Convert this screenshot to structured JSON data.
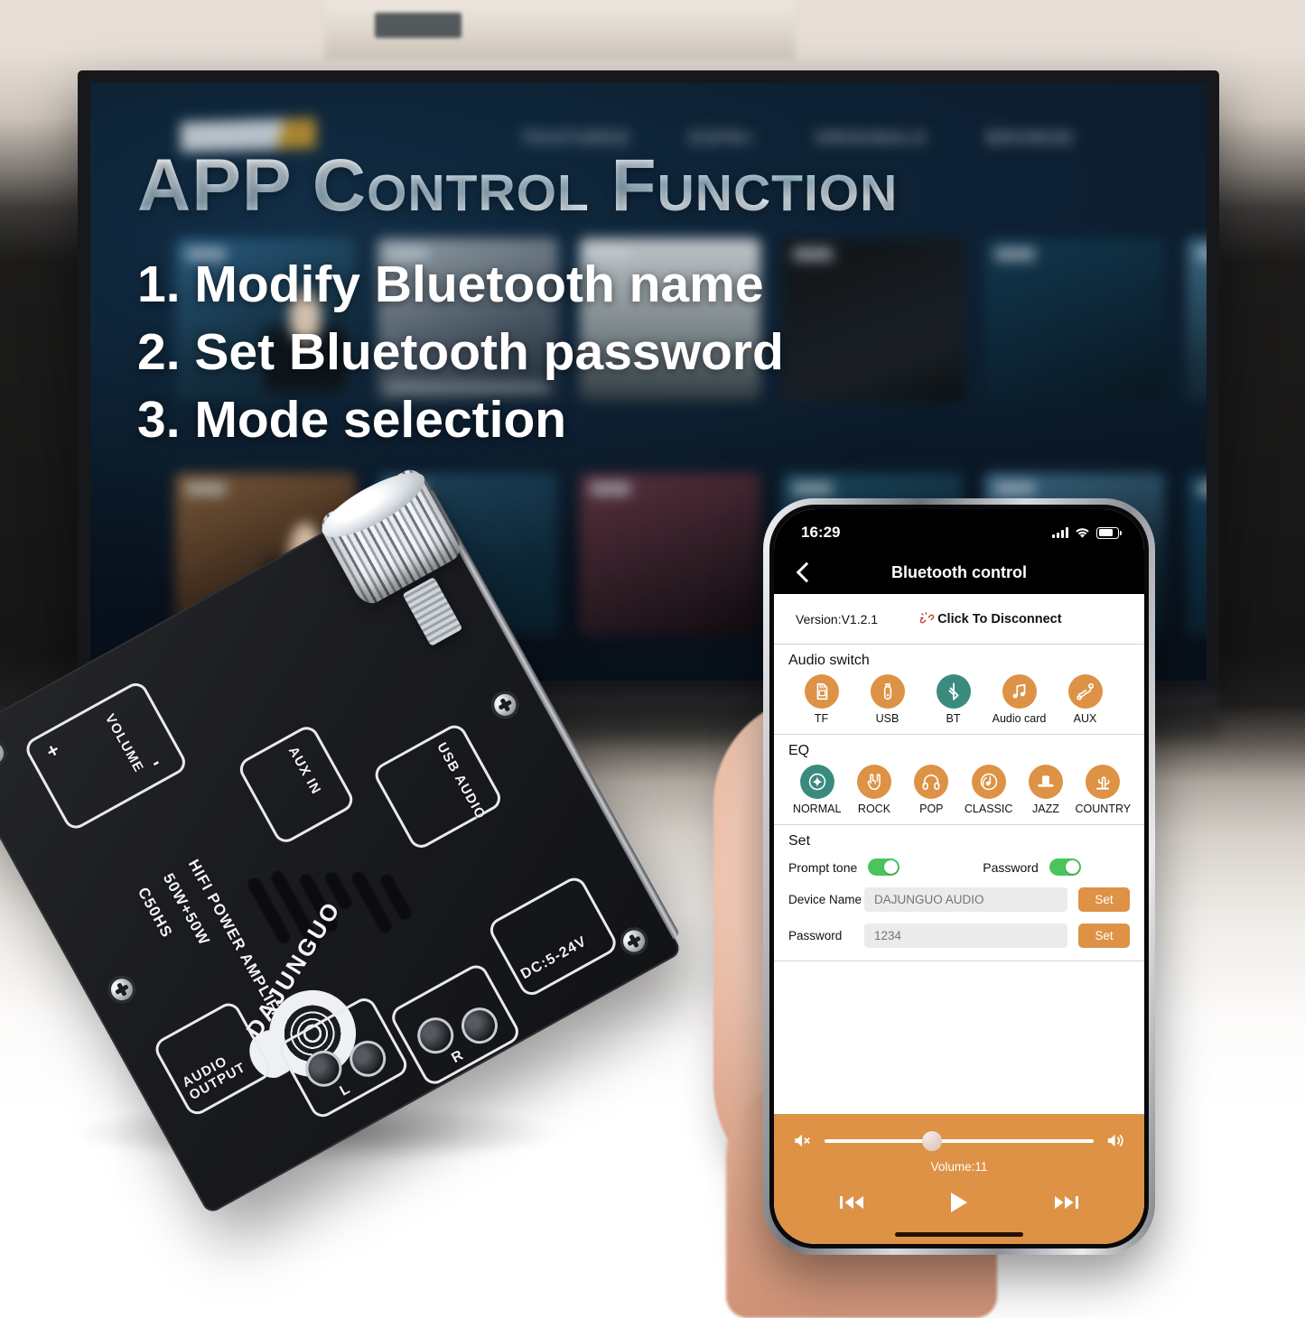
{
  "headline": {
    "title": "APP Control Function",
    "bullets": [
      "1. Modify Bluetooth name",
      "2. Set Bluetooth password",
      "3. Mode selection"
    ]
  },
  "board": {
    "model": "C50HS",
    "power": "50W+50W",
    "type": "HIFI POWER AMPLIFIER",
    "brand": "DAJUNGUO",
    "volume_label": "VOLUME",
    "plus": "+",
    "minus": "-",
    "aux_in": "AUX IN",
    "usb_audio": "USB AUDIO",
    "audio_output": "AUDIO OUTPUT",
    "left_channel": "L",
    "right_channel": "R",
    "power_in": "DC:5-24V"
  },
  "phone": {
    "status": {
      "time": "16:29",
      "signal_icon": "signal-bars-icon",
      "wifi_icon": "wifi-icon",
      "battery_icon": "battery-icon"
    },
    "titlebar": {
      "back_icon": "back-chevron-icon",
      "title": "Bluetooth control"
    },
    "version_row": {
      "version": "Version:V1.2.1",
      "disconnect_icon": "broken-link-icon",
      "disconnect_label": "Click To Disconnect"
    },
    "audio_switch": {
      "title": "Audio switch",
      "selected": "BT",
      "items": [
        {
          "label": "TF",
          "icon": "sd-card-icon",
          "selected": false
        },
        {
          "label": "USB",
          "icon": "usb-drive-icon",
          "selected": false
        },
        {
          "label": "BT",
          "icon": "bluetooth-icon",
          "selected": true
        },
        {
          "label": "Audio card",
          "icon": "music-note-icon",
          "selected": false
        },
        {
          "label": "AUX",
          "icon": "aux-cable-icon",
          "selected": false
        }
      ]
    },
    "eq": {
      "title": "EQ",
      "selected": "NORMAL",
      "items": [
        {
          "label": "NORMAL",
          "icon": "sparkle-circle-icon",
          "selected": true
        },
        {
          "label": "ROCK",
          "icon": "rock-hand-icon",
          "selected": false
        },
        {
          "label": "POP",
          "icon": "headphones-icon",
          "selected": false
        },
        {
          "label": "CLASSIC",
          "icon": "vinyl-note-icon",
          "selected": false
        },
        {
          "label": "JAZZ",
          "icon": "top-hat-icon",
          "selected": false
        },
        {
          "label": "COUNTRY",
          "icon": "cactus-icon",
          "selected": false
        }
      ]
    },
    "set": {
      "title": "Set",
      "prompt_tone_label": "Prompt tone",
      "prompt_tone_on": true,
      "password_toggle_label": "Password",
      "password_toggle_on": true,
      "device_name_label": "Device Name",
      "device_name_value": "DAJUNGUO AUDIO",
      "device_name_button": "Set",
      "password_label": "Password",
      "password_value": "1234",
      "password_button": "Set"
    },
    "player": {
      "mute_icon": "volume-mute-icon",
      "loud_icon": "volume-up-icon",
      "volume_text": "Volume:11",
      "volume_percent": 40,
      "prev_icon": "previous-track-icon",
      "play_icon": "play-icon",
      "next_icon": "next-track-icon"
    }
  },
  "colors": {
    "accent_orange": "#dd9246",
    "selected_teal": "#3a8b7e",
    "toggle_green": "#4cc45c",
    "disconnect_red": "#c0392b"
  }
}
